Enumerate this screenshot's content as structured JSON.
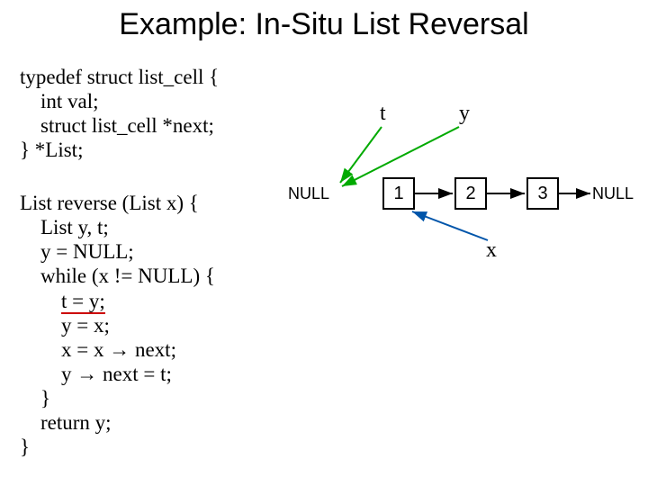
{
  "title": "Example: In-Situ List Reversal",
  "typedef": {
    "l1": "typedef struct list_cell {",
    "l2": "    int val;",
    "l3": "    struct list_cell *next;",
    "l4": "} *List;"
  },
  "reverse": {
    "l1": "List reverse (List x) {",
    "l2": "    List y, t;",
    "l3": "    y = NULL;",
    "l4": "    while (x != NULL) {",
    "l5_pre": "        ",
    "l5_ul": "t = y;",
    "l6": "        y = x;",
    "l7": "        x = x → next;",
    "l8": "        y → next = t;",
    "l9": "    }",
    "l10": "    return y;",
    "l11": "}"
  },
  "diagram": {
    "t_label": "t",
    "y_label": "y",
    "x_label": "x",
    "null_left": "NULL",
    "null_right": "NULL",
    "node1": "1",
    "node2": "2",
    "node3": "3"
  }
}
